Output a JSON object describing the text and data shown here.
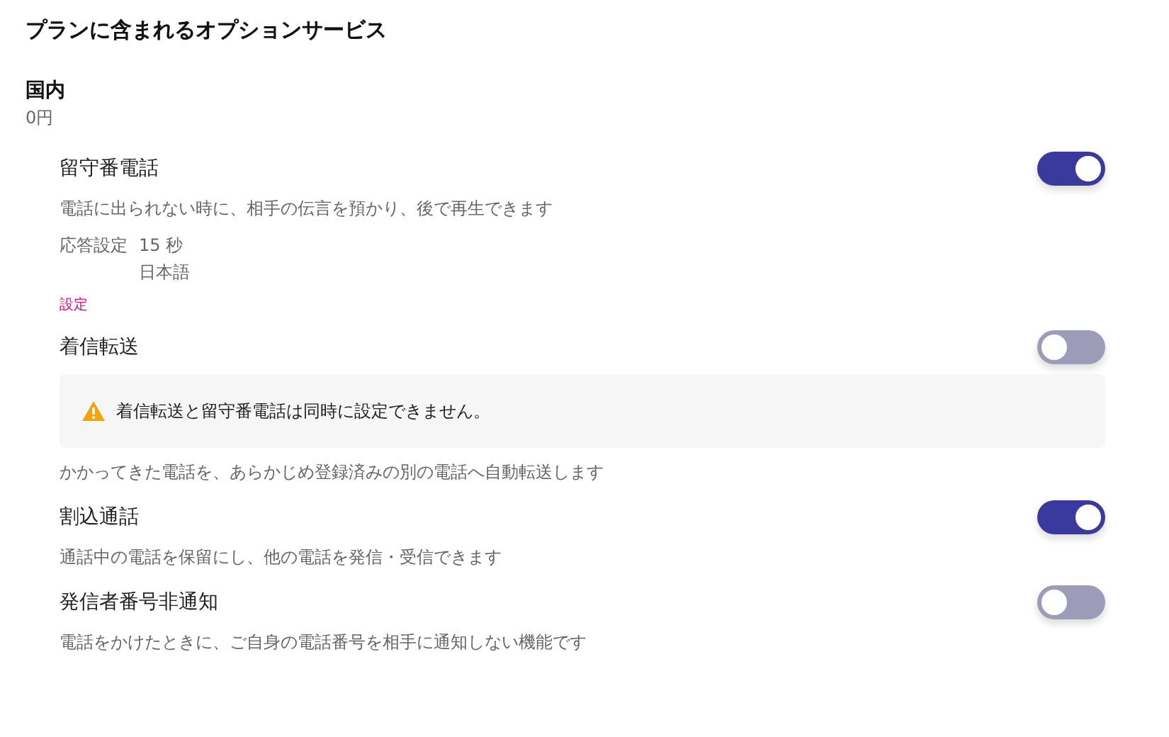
{
  "title": "プランに含まれるオプションサービス",
  "section": {
    "name": "国内",
    "price": "0円"
  },
  "services": [
    {
      "name": "留守番電話",
      "on": true,
      "description": "電話に出られない時に、相手の伝言を預かり、後で再生できます",
      "details": {
        "label": "応答設定",
        "values": [
          "15 秒",
          "日本語"
        ]
      },
      "link": "設定"
    },
    {
      "name": "着信転送",
      "on": false,
      "warning": "着信転送と留守番電話は同時に設定できません。",
      "description": "かかってきた電話を、あらかじめ登録済みの別の電話へ自動転送します"
    },
    {
      "name": "割込通話",
      "on": true,
      "description": "通話中の電話を保留にし、他の電話を発信・受信できます"
    },
    {
      "name": "発信者番号非通知",
      "on": false,
      "description": "電話をかけたときに、ご自身の電話番号を相手に通知しない機能です"
    }
  ]
}
